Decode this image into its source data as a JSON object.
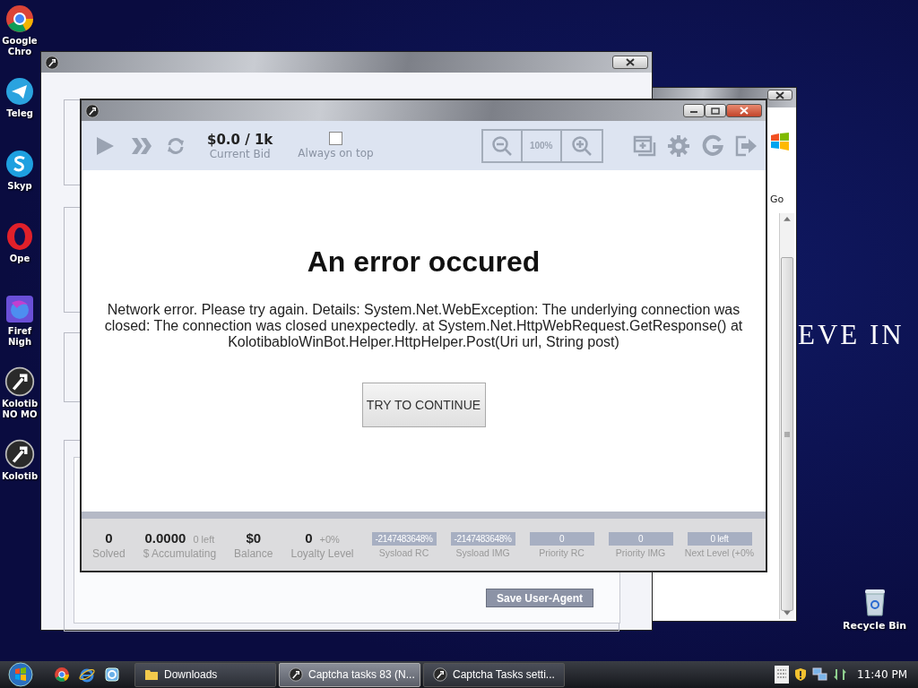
{
  "desktop": {
    "wallpaper_text": "EVE IN",
    "icons": [
      {
        "kind": "chrome",
        "lines": [
          "Google",
          "Chro"
        ]
      },
      {
        "kind": "telegram",
        "lines": [
          "Teleg"
        ]
      },
      {
        "kind": "skype",
        "lines": [
          "Skyp"
        ]
      },
      {
        "kind": "opera",
        "lines": [
          "Ope"
        ]
      },
      {
        "kind": "firefox",
        "lines": [
          "Firef",
          "Nigh"
        ]
      },
      {
        "kind": "app",
        "lines": [
          "Kolotib",
          "NO MO"
        ]
      },
      {
        "kind": "app",
        "lines": [
          "Kolotib"
        ]
      }
    ],
    "recycle_bin": {
      "label": "Recycle Bin"
    }
  },
  "browser_window": {
    "go_label": "Go"
  },
  "settings_window": {
    "save_button": "Save User-Agent"
  },
  "main_window": {
    "toolbar": {
      "current_bid": {
        "value": "$0.0 / 1k",
        "label": "Current Bid"
      },
      "always_on_top": {
        "label": "Always on top",
        "checked": false
      },
      "zoom_level": "100%"
    },
    "error": {
      "title": "An error occured",
      "message": "Network error. Please try again. Details: System.Net.WebException: The underlying connection was closed: The connection was closed unexpectedly. at System.Net.HttpWebRequest.GetResponse() at KolotibabloWinBot.Helper.HttpHelper.Post(Uri url, String post)",
      "button": "TRY TO CONTINUE"
    },
    "stats": [
      {
        "kind": "stat",
        "value": "0",
        "label": "Solved"
      },
      {
        "kind": "stat",
        "value": "0.0000",
        "sub": "0 left",
        "label": "$ Accumulating"
      },
      {
        "kind": "stat",
        "value": "$0",
        "label": "Balance"
      },
      {
        "kind": "stat",
        "value": "0",
        "sub": "+0%",
        "label": "Loyalty Level"
      },
      {
        "kind": "bar",
        "value": "-2147483648%",
        "label": "Sysload RC"
      },
      {
        "kind": "bar",
        "value": "-2147483648%",
        "label": "Sysload IMG"
      },
      {
        "kind": "bar",
        "value": "0",
        "label": "Priority RC"
      },
      {
        "kind": "bar",
        "value": "0",
        "label": "Priority IMG"
      },
      {
        "kind": "bar",
        "value": "0 left",
        "label": "Next Level (+0%"
      }
    ]
  },
  "taskbar": {
    "tasks": [
      {
        "kind": "folder",
        "label": "Downloads",
        "selected": false
      },
      {
        "kind": "app",
        "label": "Captcha tasks 83 (N...",
        "selected": true
      },
      {
        "kind": "app",
        "label": "Captcha Tasks setti...",
        "selected": false
      }
    ],
    "clock": "11:40 PM"
  }
}
